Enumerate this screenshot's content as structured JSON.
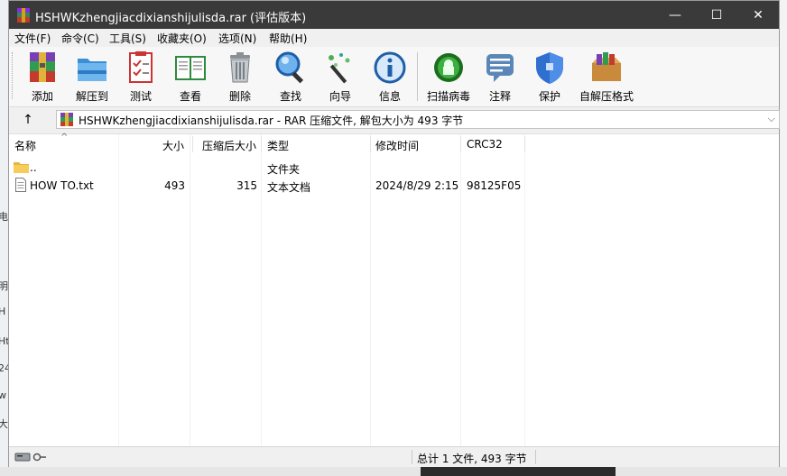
{
  "window": {
    "title": "HSHWKzhengjiacdixianshijulisda.rar (评估版本)",
    "colors": {
      "titlebar": "#3a3a3a",
      "accent": "#0a64ad"
    }
  },
  "controls": {
    "minimize": "—",
    "maximize": "☐",
    "close": "✕"
  },
  "menubar": [
    {
      "label": "文件(F)"
    },
    {
      "label": "命令(C)"
    },
    {
      "label": "工具(S)"
    },
    {
      "label": "收藏夹(O)"
    },
    {
      "label": "选项(N)"
    },
    {
      "label": "帮助(H)"
    }
  ],
  "toolbar": [
    {
      "label": "添加",
      "icon": "add-archive-icon"
    },
    {
      "label": "解压到",
      "icon": "extract-folder-icon"
    },
    {
      "label": "测试",
      "icon": "test-checklist-icon"
    },
    {
      "label": "查看",
      "icon": "view-book-icon"
    },
    {
      "label": "删除",
      "icon": "trash-icon"
    },
    {
      "label": "查找",
      "icon": "magnifier-icon"
    },
    {
      "label": "向导",
      "icon": "wizard-wand-icon"
    },
    {
      "label": "信息",
      "icon": "info-icon"
    },
    {
      "label": "扫描病毒",
      "icon": "virus-scan-icon"
    },
    {
      "label": "注释",
      "icon": "comment-icon"
    },
    {
      "label": "保护",
      "icon": "shield-icon"
    },
    {
      "label": "自解压格式",
      "icon": "sfx-box-icon"
    }
  ],
  "address": {
    "up": "↑",
    "path": "HSHWKzhengjiacdixianshijulisda.rar - RAR 压缩文件, 解包大小为 493 字节",
    "dropdown": "⌵"
  },
  "columns": {
    "name": "名称",
    "size": "大小",
    "packed": "压缩后大小",
    "type": "类型",
    "modified": "修改时间",
    "crc": "CRC32",
    "sort_arrow": "^"
  },
  "files": [
    {
      "name": "..",
      "size": "",
      "packed": "",
      "type": "文件夹",
      "modified": "",
      "crc": "",
      "icon": "folder-icon"
    },
    {
      "name": "HOW TO.txt",
      "size": "493",
      "packed": "315",
      "type": "文本文档",
      "modified": "2024/8/29 2:15",
      "crc": "98125F05",
      "icon": "text-file-icon"
    }
  ],
  "status": {
    "summary": "总计 1 文件, 493 字节",
    "icon": "drive-key-icon"
  },
  "background": {
    "left_glyphs": [
      "电",
      "明",
      "H",
      "Ht",
      "24",
      "w",
      "大"
    ]
  }
}
